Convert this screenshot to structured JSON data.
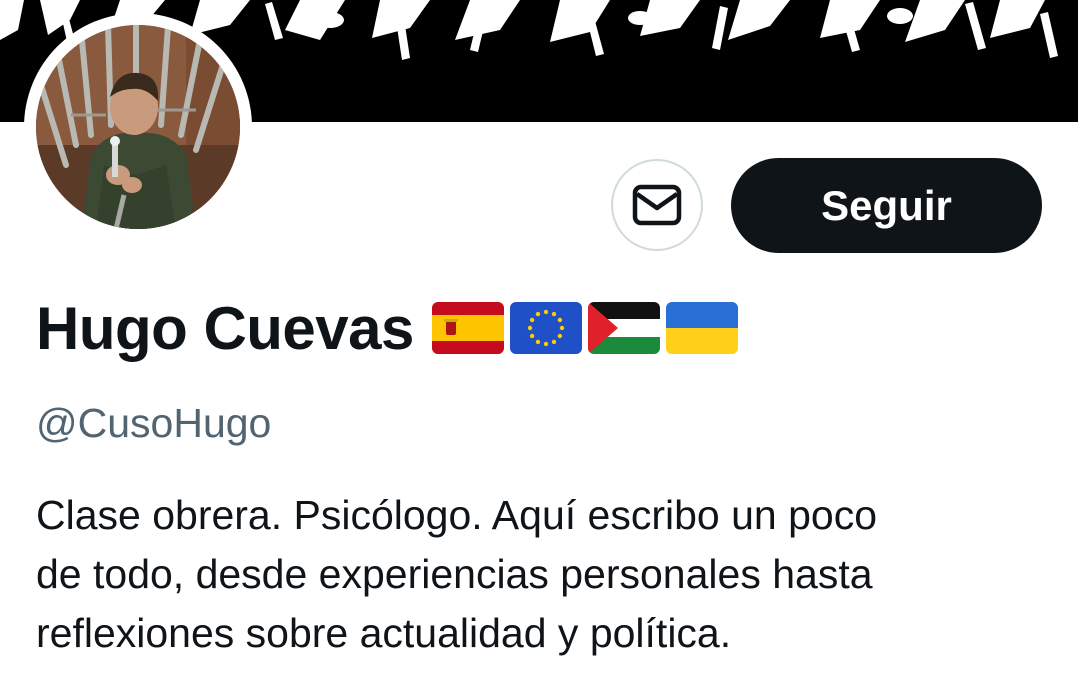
{
  "profile": {
    "display_name": "Hugo Cuevas",
    "handle": "@CusoHugo",
    "flags": [
      "spain-flag",
      "eu-flag",
      "palestine-flag",
      "ukraine-flag"
    ],
    "bio_lines": [
      "Clase obrera. Psicólogo. Aquí escribo un poco",
      "de todo, desde experiencias personales hasta",
      "reflexiones sobre actualidad y política."
    ]
  },
  "actions": {
    "message_icon": "envelope-icon",
    "follow_label": "Seguir"
  },
  "colors": {
    "text_primary": "#0f1419",
    "text_secondary": "#536471",
    "border": "#cfd9de",
    "follow_bg": "#0f1419",
    "follow_text": "#ffffff"
  }
}
